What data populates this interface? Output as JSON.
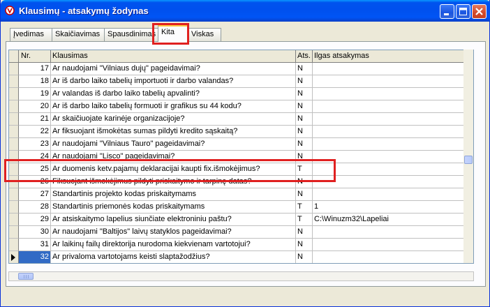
{
  "window": {
    "title": "Klausimų - atsakymų žodynas",
    "icon": "app-icon",
    "controls": [
      "minimize-icon",
      "maximize-icon",
      "close-icon"
    ]
  },
  "tabs": [
    {
      "label": "Įvedimas",
      "active": false
    },
    {
      "label": "Skaičiavimas",
      "active": false
    },
    {
      "label": "Spausdinimas",
      "active": false
    },
    {
      "label": "Kita",
      "active": true
    },
    {
      "label": "Viskas",
      "active": false
    }
  ],
  "grid": {
    "columns": {
      "nr": "Nr.",
      "question": "Klausimas",
      "ats": "Ats.",
      "answer": "Ilgas atsakymas"
    },
    "rows": [
      {
        "nr": "17",
        "question": "Ar naudojami \"Vilniaus dujų\" pageidavimai?",
        "ats": "N",
        "answer": ""
      },
      {
        "nr": "18",
        "question": "Ar iš darbo laiko tabelių importuoti ir darbo valandas?",
        "ats": "N",
        "answer": ""
      },
      {
        "nr": "19",
        "question": "Ar valandas iš darbo laiko tabelių apvalinti?",
        "ats": "N",
        "answer": ""
      },
      {
        "nr": "20",
        "question": "Ar iš darbo laiko tabelių formuoti ir grafikus su 44 kodu?",
        "ats": "N",
        "answer": ""
      },
      {
        "nr": "21",
        "question": "Ar skaičiuojate karinėje organizacijoje?",
        "ats": "N",
        "answer": ""
      },
      {
        "nr": "22",
        "question": "Ar fiksuojant išmokėtas sumas pildyti kredito sąskaitą?",
        "ats": "N",
        "answer": ""
      },
      {
        "nr": "23",
        "question": "Ar naudojami \"Vilniaus Tauro\" pageidavimai?",
        "ats": "N",
        "answer": ""
      },
      {
        "nr": "24",
        "question": "Ar naudojami \"Lisco\" pageidavimai?",
        "ats": "N",
        "answer": ""
      },
      {
        "nr": "25",
        "question": "Ar duomenis ketv.pajamų deklaracijai kaupti fix.išmokėjimus?",
        "ats": "T",
        "answer": ""
      },
      {
        "nr": "26",
        "question": "Fiksuojant išmokėjimus pildyti priskaitymo ir tarpinę datas?",
        "ats": "N",
        "answer": ""
      },
      {
        "nr": "27",
        "question": "Standartinis projekto kodas priskaitymams",
        "ats": "N",
        "answer": ""
      },
      {
        "nr": "28",
        "question": "Standartinis priemonės kodas priskaitymams",
        "ats": "T",
        "answer": "1"
      },
      {
        "nr": "29",
        "question": "Ar atsiskaitymo lapelius siunčiate elektroniniu paštu?",
        "ats": "T",
        "answer": "C:\\Winuzm32\\Lapeliai"
      },
      {
        "nr": "30",
        "question": "Ar naudojami \"Baltijos\" laivų statyklos pageidavimai?",
        "ats": "N",
        "answer": ""
      },
      {
        "nr": "31",
        "question": "Ar laikinų failų direktorija nurodoma kiekvienam vartotojui?",
        "ats": "N",
        "answer": ""
      },
      {
        "nr": "32",
        "question": "Ar privaloma vartotojams keisti slaptažodžius?",
        "ats": "N",
        "answer": ""
      }
    ]
  },
  "colors": {
    "title_bar": "#0055ee",
    "selection": "#316ac5",
    "highlight": "#e02020",
    "tab_accent": "#ffc83c"
  }
}
